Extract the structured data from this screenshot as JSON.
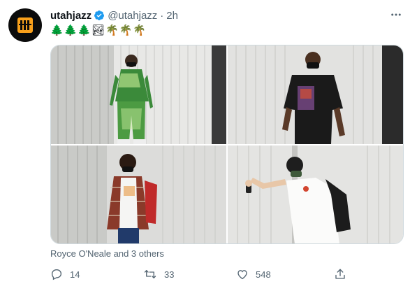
{
  "tweet": {
    "display_name": "utahjazz",
    "handle": "@utahjazz",
    "separator": "·",
    "timestamp": "2h",
    "verified": true,
    "text_emojis": "🌲🌲🌲🏞🌴🌴🌴",
    "tagged_text": "Royce O'Neale and 3 others",
    "counts": {
      "replies": "14",
      "retweets": "33",
      "likes": "548"
    }
  },
  "media": [
    {
      "caption": "player in green tie-dye outfit walking"
    },
    {
      "caption": "player in black t-shirt with backpack"
    },
    {
      "caption": "player in plaid flannel shirt with red backpack"
    },
    {
      "caption": "player in white t-shirt holding phone"
    }
  ],
  "icons": {
    "avatar": "jazz-logo-icon",
    "verified": "verified-badge-icon",
    "more": "more-icon",
    "reply": "reply-icon",
    "retweet": "retweet-icon",
    "like": "heart-icon",
    "share": "share-icon"
  },
  "colors": {
    "verified": "#1d9bf0",
    "text_secondary": "#536471",
    "logo_gold": "#f9a01b"
  }
}
